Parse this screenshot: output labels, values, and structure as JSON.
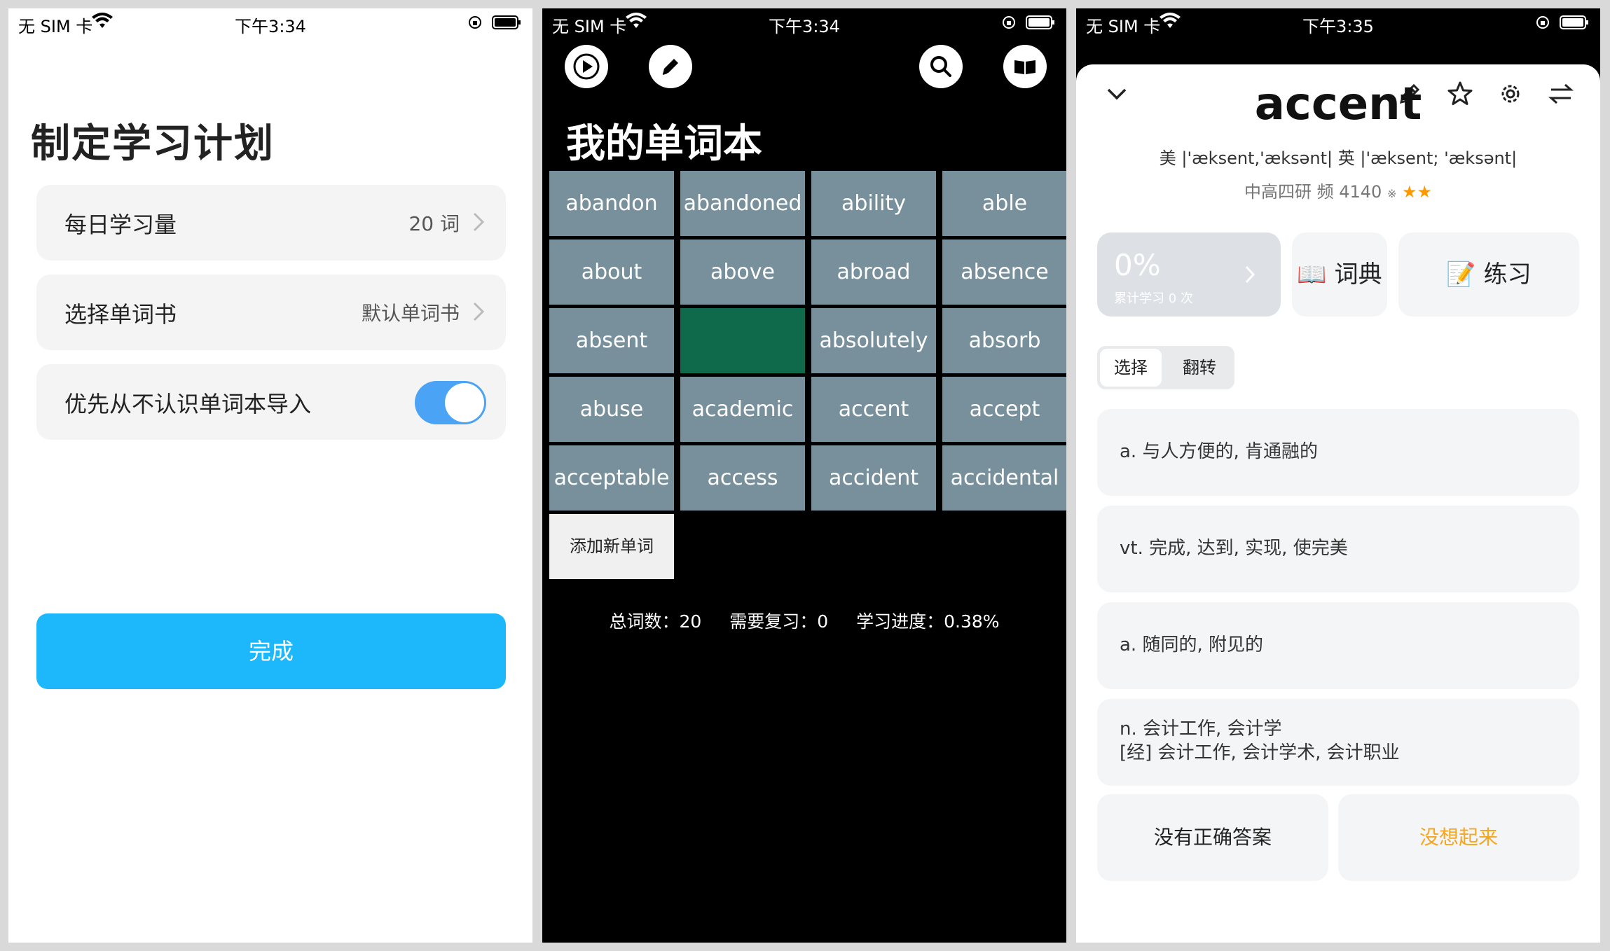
{
  "status_bars": [
    {
      "carrier": "无 SIM 卡",
      "time": "下午3:34"
    },
    {
      "carrier": "无 SIM 卡",
      "time": "下午3:34"
    },
    {
      "carrier": "无 SIM 卡",
      "time": "下午3:35"
    }
  ],
  "plan": {
    "title": "制定学习计划",
    "daily_label": "每日学习量",
    "daily_value": "20 词",
    "book_label": "选择单词书",
    "book_value": "默认单词书",
    "import_label": "优先从不认识单词本导入",
    "import_toggle_on": true,
    "done_button": "完成"
  },
  "wordbook": {
    "title": "我的单词本",
    "toolbar_icons": [
      "play-icon",
      "edit-icon",
      "search-icon",
      "book-icon"
    ],
    "words": [
      "abandon",
      "abandoned",
      "ability",
      "able",
      "about",
      "above",
      "abroad",
      "absence",
      "absent",
      "",
      "absolutely",
      "absorb",
      "abuse",
      "academic",
      "accent",
      "accept",
      "acceptable",
      "access",
      "accident",
      "accidental"
    ],
    "highlighted_index": 9,
    "add_word": "添加新单词",
    "stats": {
      "total": "总词数：20",
      "review": "需要复习：0",
      "progress": "学习进度：0.38%"
    },
    "colors": {
      "tile": "#78909c",
      "highlight": "#0f6a4b"
    }
  },
  "detail": {
    "word": "accent",
    "phonetic": "美 |'æksent,'æksənt|  英 |'æksent; 'æksənt|",
    "tags": "中高四研 频 4140",
    "tag_mark": "※",
    "stars": "★★",
    "progress_pct": "0%",
    "progress_sub": "累计学习 0 次",
    "dict_button": "📖 词典",
    "practice_button": "📝 练习",
    "mode_tabs": [
      "选择",
      "翻转"
    ],
    "definitions": [
      "a. 与人方便的, 肯通融的",
      "vt. 完成, 达到, 实现, 使完美",
      "a. 随同的, 附见的",
      "n. 会计工作, 会计学",
      "[经] 会计工作, 会计学术, 会计职业"
    ],
    "answer_none": "没有正确答案",
    "answer_forgot": "没想起来",
    "colors": {
      "forgot": "#f5a623",
      "stars": "#ff9900"
    }
  }
}
